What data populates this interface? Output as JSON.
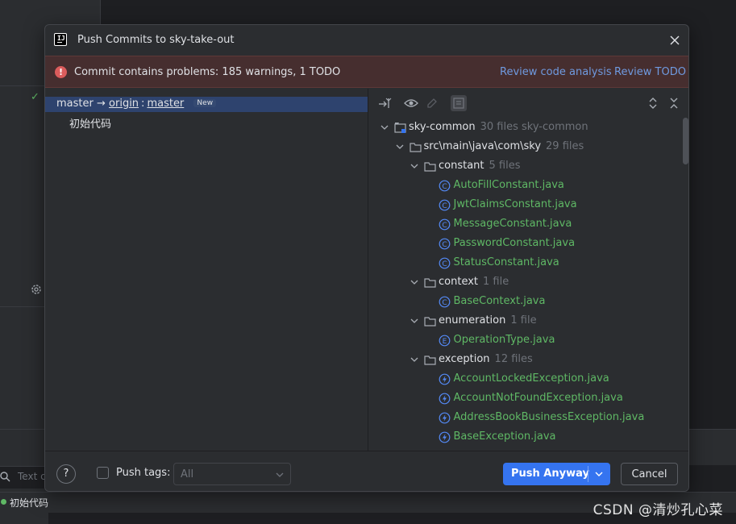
{
  "background": {
    "search_placeholder": "Text c",
    "status_commit": "初始代码",
    "watermark": "CSDN @清炒孔心菜"
  },
  "dialog": {
    "title": "Push Commits to sky-take-out",
    "app_icon": "intellij-logo-icon",
    "warning": {
      "message": "Commit contains problems: 185 warnings, 1 TODO",
      "review_analysis": "Review code analysis",
      "review_todo": "Review TODO",
      "color": "#db5c5c"
    },
    "branch": {
      "local": "master",
      "arrow": "→",
      "remote": "origin",
      "sep": ":",
      "remote_branch": "master",
      "badge": "New"
    },
    "commits": [
      "初始代码"
    ],
    "toolbar": {
      "icons": [
        "expand-collapse-icon",
        "eye-icon",
        "edit-icon",
        "group-icon",
        "expand-all-icon",
        "collapse-all-icon"
      ]
    },
    "tree": [
      {
        "depth": 0,
        "kind": "module",
        "name": "sky-common",
        "meta": "30 files  sky-common",
        "expanded": true
      },
      {
        "depth": 1,
        "kind": "folder",
        "name": "src\\main\\java\\com\\sky",
        "meta": "29 files",
        "expanded": true
      },
      {
        "depth": 2,
        "kind": "folder",
        "name": "constant",
        "meta": "5 files",
        "expanded": true
      },
      {
        "depth": 3,
        "kind": "class",
        "name": "AutoFillConstant.java"
      },
      {
        "depth": 3,
        "kind": "class",
        "name": "JwtClaimsConstant.java"
      },
      {
        "depth": 3,
        "kind": "class",
        "name": "MessageConstant.java"
      },
      {
        "depth": 3,
        "kind": "class",
        "name": "PasswordConstant.java"
      },
      {
        "depth": 3,
        "kind": "class",
        "name": "StatusConstant.java"
      },
      {
        "depth": 2,
        "kind": "folder",
        "name": "context",
        "meta": "1 file",
        "expanded": true
      },
      {
        "depth": 3,
        "kind": "class",
        "name": "BaseContext.java"
      },
      {
        "depth": 2,
        "kind": "folder",
        "name": "enumeration",
        "meta": "1 file",
        "expanded": true
      },
      {
        "depth": 3,
        "kind": "enum",
        "name": "OperationType.java"
      },
      {
        "depth": 2,
        "kind": "folder",
        "name": "exception",
        "meta": "12 files",
        "expanded": true
      },
      {
        "depth": 3,
        "kind": "exception",
        "name": "AccountLockedException.java"
      },
      {
        "depth": 3,
        "kind": "exception",
        "name": "AccountNotFoundException.java"
      },
      {
        "depth": 3,
        "kind": "exception",
        "name": "AddressBookBusinessException.java"
      },
      {
        "depth": 3,
        "kind": "exception",
        "name": "BaseException.java"
      }
    ],
    "footer": {
      "help": "?",
      "push_tags_label": "Push tags:",
      "tags_select_value": "All",
      "push_button": "Push Anyway",
      "cancel_button": "Cancel",
      "accent": "#3574f0"
    }
  }
}
